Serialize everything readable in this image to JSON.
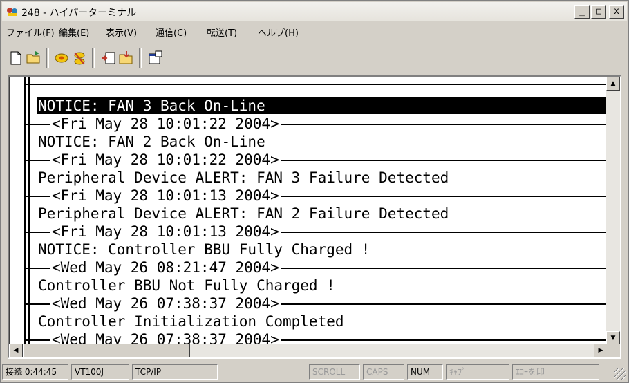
{
  "window": {
    "title": "248 - ハイパーターミナル"
  },
  "title_buttons": {
    "minimize": "_",
    "maximize": "□",
    "close": "x"
  },
  "menu": [
    "ファイル(F)",
    "編集(E)",
    "表示(V)",
    "通信(C)",
    "転送(T)",
    "ヘルプ(H)"
  ],
  "toolbar": [
    "new-icon",
    "open-icon",
    "connect-icon",
    "disconnect-icon",
    "send-icon",
    "receive-icon",
    "properties-icon"
  ],
  "terminal": {
    "selected_line": "NOTICE: FAN 3 Back On-Line",
    "entries": [
      {
        "ts": "<Fri May 28 10:01:22 2004>",
        "msg": "NOTICE: FAN 2 Back On-Line"
      },
      {
        "ts": "<Fri May 28 10:01:22 2004>",
        "msg": "Peripheral Device ALERT: FAN 3 Failure Detected"
      },
      {
        "ts": "<Fri May 28 10:01:13 2004>",
        "msg": "Peripheral Device ALERT: FAN 2 Failure Detected"
      },
      {
        "ts": "<Fri May 28 10:01:13 2004>",
        "msg": "NOTICE: Controller BBU Fully Charged !"
      },
      {
        "ts": "<Wed May 26 08:21:47 2004>",
        "msg": "Controller BBU Not Fully Charged !"
      },
      {
        "ts": "<Wed May 26 07:38:37 2004>",
        "msg": "Controller Initialization Completed"
      },
      {
        "ts": "<Wed May 26 07:38:37 2004>",
        "msg": ""
      }
    ]
  },
  "statusbar": {
    "connected": "接続 0:44:45",
    "emulation": "VT100J",
    "protocol": "TCP/IP",
    "scroll": "SCROLL",
    "caps": "CAPS",
    "num": "NUM",
    "capture": "ｷｬﾌﾟ",
    "echo": "ｴｺｰを印"
  }
}
